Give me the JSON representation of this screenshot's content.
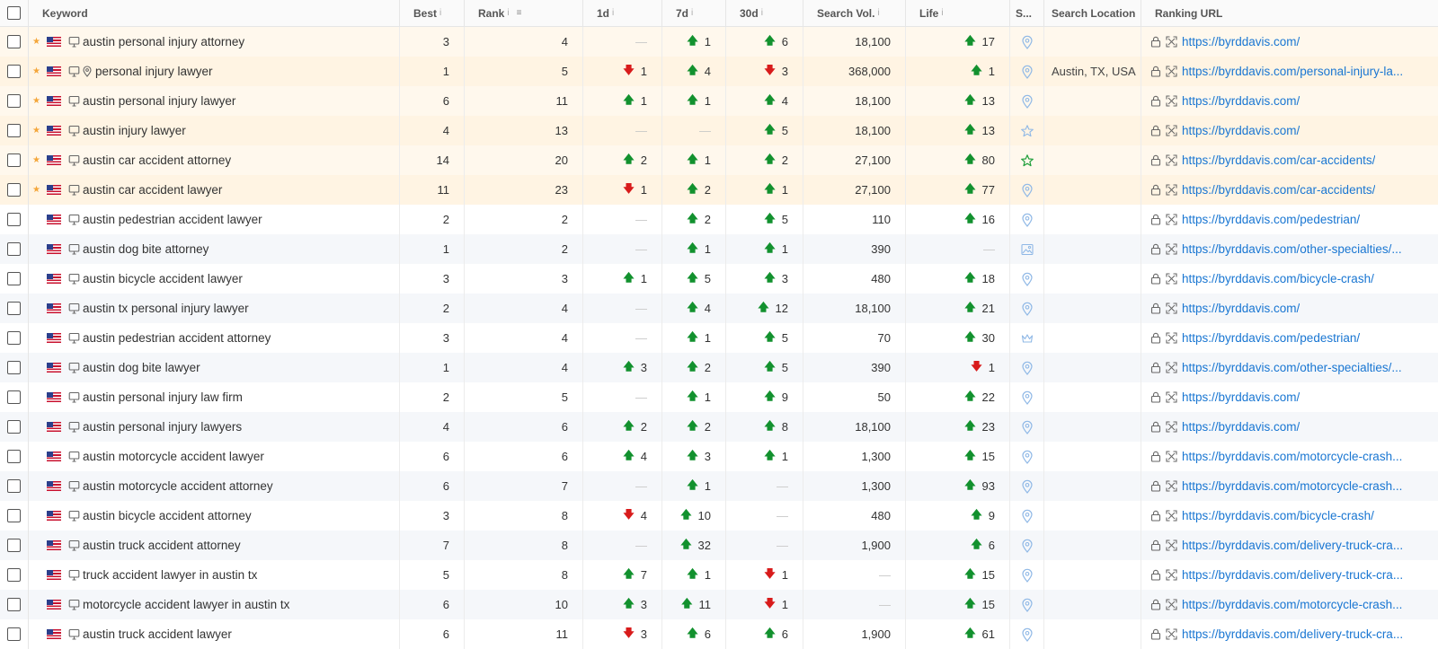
{
  "headers": {
    "keyword": "Keyword",
    "best": "Best",
    "rank": "Rank",
    "d1": "1d",
    "d7": "7d",
    "d30": "30d",
    "search_vol": "Search Vol.",
    "life": "Life",
    "serp": "S...",
    "search_location": "Search Location",
    "ranking_url": "Ranking URL",
    "info_glyph": "i",
    "sort_glyph": "≡"
  },
  "glyphs": {
    "up": "🡅",
    "down": "🡇",
    "dash": "—",
    "star": "★"
  },
  "colors": {
    "up": "#12912e",
    "down": "#d81b1b",
    "link": "#1976d2",
    "star": "#f4a63a",
    "highlight": "#fff8ed"
  },
  "rows": [
    {
      "starred": true,
      "keyword": "austin personal injury attorney",
      "local": false,
      "best": "3",
      "rank": "4",
      "d1": null,
      "d7": {
        "dir": "up",
        "v": "1"
      },
      "d30": {
        "dir": "up",
        "v": "6"
      },
      "vol": "18,100",
      "life": {
        "dir": "up",
        "v": "17"
      },
      "serp": "pin-icon",
      "location": "",
      "url": "https://byrddavis.com/"
    },
    {
      "starred": true,
      "keyword": "personal injury lawyer",
      "local": true,
      "best": "1",
      "rank": "5",
      "d1": {
        "dir": "down",
        "v": "1"
      },
      "d7": {
        "dir": "up",
        "v": "4"
      },
      "d30": {
        "dir": "down",
        "v": "3"
      },
      "vol": "368,000",
      "life": {
        "dir": "up",
        "v": "1"
      },
      "serp": "pin-icon",
      "location": "Austin, TX, USA",
      "url": "https://byrddavis.com/personal-injury-la..."
    },
    {
      "starred": true,
      "keyword": "austin personal injury lawyer",
      "local": false,
      "best": "6",
      "rank": "11",
      "d1": {
        "dir": "up",
        "v": "1"
      },
      "d7": {
        "dir": "up",
        "v": "1"
      },
      "d30": {
        "dir": "up",
        "v": "4"
      },
      "vol": "18,100",
      "life": {
        "dir": "up",
        "v": "13"
      },
      "serp": "pin-icon",
      "location": "",
      "url": "https://byrddavis.com/"
    },
    {
      "starred": true,
      "keyword": "austin injury lawyer",
      "local": false,
      "best": "4",
      "rank": "13",
      "d1": null,
      "d7": null,
      "d30": {
        "dir": "up",
        "v": "5"
      },
      "vol": "18,100",
      "life": {
        "dir": "up",
        "v": "13"
      },
      "serp": "star-icon",
      "location": "",
      "url": "https://byrddavis.com/"
    },
    {
      "starred": true,
      "keyword": "austin car accident attorney",
      "local": false,
      "best": "14",
      "rank": "20",
      "d1": {
        "dir": "up",
        "v": "2"
      },
      "d7": {
        "dir": "up",
        "v": "1"
      },
      "d30": {
        "dir": "up",
        "v": "2"
      },
      "vol": "27,100",
      "life": {
        "dir": "up",
        "v": "80"
      },
      "serp": "star-icon-green",
      "location": "",
      "url": "https://byrddavis.com/car-accidents/"
    },
    {
      "starred": true,
      "keyword": "austin car accident lawyer",
      "local": false,
      "best": "11",
      "rank": "23",
      "d1": {
        "dir": "down",
        "v": "1"
      },
      "d7": {
        "dir": "up",
        "v": "2"
      },
      "d30": {
        "dir": "up",
        "v": "1"
      },
      "vol": "27,100",
      "life": {
        "dir": "up",
        "v": "77"
      },
      "serp": "pin-icon",
      "location": "",
      "url": "https://byrddavis.com/car-accidents/"
    },
    {
      "starred": false,
      "keyword": "austin pedestrian accident lawyer",
      "local": false,
      "best": "2",
      "rank": "2",
      "d1": null,
      "d7": {
        "dir": "up",
        "v": "2"
      },
      "d30": {
        "dir": "up",
        "v": "5"
      },
      "vol": "110",
      "life": {
        "dir": "up",
        "v": "16"
      },
      "serp": "pin-icon",
      "location": "",
      "url": "https://byrddavis.com/pedestrian/"
    },
    {
      "starred": false,
      "keyword": "austin dog bite attorney",
      "local": false,
      "best": "1",
      "rank": "2",
      "d1": null,
      "d7": {
        "dir": "up",
        "v": "1"
      },
      "d30": {
        "dir": "up",
        "v": "1"
      },
      "vol": "390",
      "life": null,
      "serp": "image-icon",
      "location": "",
      "url": "https://byrddavis.com/other-specialties/..."
    },
    {
      "starred": false,
      "keyword": "austin bicycle accident lawyer",
      "local": false,
      "best": "3",
      "rank": "3",
      "d1": {
        "dir": "up",
        "v": "1"
      },
      "d7": {
        "dir": "up",
        "v": "5"
      },
      "d30": {
        "dir": "up",
        "v": "3"
      },
      "vol": "480",
      "life": {
        "dir": "up",
        "v": "18"
      },
      "serp": "pin-icon",
      "location": "",
      "url": "https://byrddavis.com/bicycle-crash/"
    },
    {
      "starred": false,
      "keyword": "austin tx personal injury lawyer",
      "local": false,
      "best": "2",
      "rank": "4",
      "d1": null,
      "d7": {
        "dir": "up",
        "v": "4"
      },
      "d30": {
        "dir": "up",
        "v": "12"
      },
      "vol": "18,100",
      "life": {
        "dir": "up",
        "v": "21"
      },
      "serp": "pin-icon",
      "location": "",
      "url": "https://byrddavis.com/"
    },
    {
      "starred": false,
      "keyword": "austin pedestrian accident attorney",
      "local": false,
      "best": "3",
      "rank": "4",
      "d1": null,
      "d7": {
        "dir": "up",
        "v": "1"
      },
      "d30": {
        "dir": "up",
        "v": "5"
      },
      "vol": "70",
      "life": {
        "dir": "up",
        "v": "30"
      },
      "serp": "crown-icon",
      "location": "",
      "url": "https://byrddavis.com/pedestrian/"
    },
    {
      "starred": false,
      "keyword": "austin dog bite lawyer",
      "local": false,
      "best": "1",
      "rank": "4",
      "d1": {
        "dir": "up",
        "v": "3"
      },
      "d7": {
        "dir": "up",
        "v": "2"
      },
      "d30": {
        "dir": "up",
        "v": "5"
      },
      "vol": "390",
      "life": {
        "dir": "down",
        "v": "1"
      },
      "serp": "pin-icon",
      "location": "",
      "url": "https://byrddavis.com/other-specialties/..."
    },
    {
      "starred": false,
      "keyword": "austin personal injury law firm",
      "local": false,
      "best": "2",
      "rank": "5",
      "d1": null,
      "d7": {
        "dir": "up",
        "v": "1"
      },
      "d30": {
        "dir": "up",
        "v": "9"
      },
      "vol": "50",
      "life": {
        "dir": "up",
        "v": "22"
      },
      "serp": "pin-icon",
      "location": "",
      "url": "https://byrddavis.com/"
    },
    {
      "starred": false,
      "keyword": "austin personal injury lawyers",
      "local": false,
      "best": "4",
      "rank": "6",
      "d1": {
        "dir": "up",
        "v": "2"
      },
      "d7": {
        "dir": "up",
        "v": "2"
      },
      "d30": {
        "dir": "up",
        "v": "8"
      },
      "vol": "18,100",
      "life": {
        "dir": "up",
        "v": "23"
      },
      "serp": "pin-icon",
      "location": "",
      "url": "https://byrddavis.com/"
    },
    {
      "starred": false,
      "keyword": "austin motorcycle accident lawyer",
      "local": false,
      "best": "6",
      "rank": "6",
      "d1": {
        "dir": "up",
        "v": "4"
      },
      "d7": {
        "dir": "up",
        "v": "3"
      },
      "d30": {
        "dir": "up",
        "v": "1"
      },
      "vol": "1,300",
      "life": {
        "dir": "up",
        "v": "15"
      },
      "serp": "pin-icon",
      "location": "",
      "url": "https://byrddavis.com/motorcycle-crash..."
    },
    {
      "starred": false,
      "keyword": "austin motorcycle accident attorney",
      "local": false,
      "best": "6",
      "rank": "7",
      "d1": null,
      "d7": {
        "dir": "up",
        "v": "1"
      },
      "d30": null,
      "vol": "1,300",
      "life": {
        "dir": "up",
        "v": "93"
      },
      "serp": "pin-icon",
      "location": "",
      "url": "https://byrddavis.com/motorcycle-crash..."
    },
    {
      "starred": false,
      "keyword": "austin bicycle accident attorney",
      "local": false,
      "best": "3",
      "rank": "8",
      "d1": {
        "dir": "down",
        "v": "4"
      },
      "d7": {
        "dir": "up",
        "v": "10"
      },
      "d30": null,
      "vol": "480",
      "life": {
        "dir": "up",
        "v": "9"
      },
      "serp": "pin-icon",
      "location": "",
      "url": "https://byrddavis.com/bicycle-crash/"
    },
    {
      "starred": false,
      "keyword": "austin truck accident attorney",
      "local": false,
      "best": "7",
      "rank": "8",
      "d1": null,
      "d7": {
        "dir": "up",
        "v": "32"
      },
      "d30": null,
      "vol": "1,900",
      "life": {
        "dir": "up",
        "v": "6"
      },
      "serp": "pin-icon",
      "location": "",
      "url": "https://byrddavis.com/delivery-truck-cra..."
    },
    {
      "starred": false,
      "keyword": "truck accident lawyer in austin tx",
      "local": false,
      "best": "5",
      "rank": "8",
      "d1": {
        "dir": "up",
        "v": "7"
      },
      "d7": {
        "dir": "up",
        "v": "1"
      },
      "d30": {
        "dir": "down",
        "v": "1"
      },
      "vol": null,
      "life": {
        "dir": "up",
        "v": "15"
      },
      "serp": "pin-icon",
      "location": "",
      "url": "https://byrddavis.com/delivery-truck-cra..."
    },
    {
      "starred": false,
      "keyword": "motorcycle accident lawyer in austin tx",
      "local": false,
      "best": "6",
      "rank": "10",
      "d1": {
        "dir": "up",
        "v": "3"
      },
      "d7": {
        "dir": "up",
        "v": "11"
      },
      "d30": {
        "dir": "down",
        "v": "1"
      },
      "vol": null,
      "life": {
        "dir": "up",
        "v": "15"
      },
      "serp": "pin-icon",
      "location": "",
      "url": "https://byrddavis.com/motorcycle-crash..."
    },
    {
      "starred": false,
      "keyword": "austin truck accident lawyer",
      "local": false,
      "best": "6",
      "rank": "11",
      "d1": {
        "dir": "down",
        "v": "3"
      },
      "d7": {
        "dir": "up",
        "v": "6"
      },
      "d30": {
        "dir": "up",
        "v": "6"
      },
      "vol": "1,900",
      "life": {
        "dir": "up",
        "v": "61"
      },
      "serp": "pin-icon",
      "location": "",
      "url": "https://byrddavis.com/delivery-truck-cra..."
    }
  ]
}
